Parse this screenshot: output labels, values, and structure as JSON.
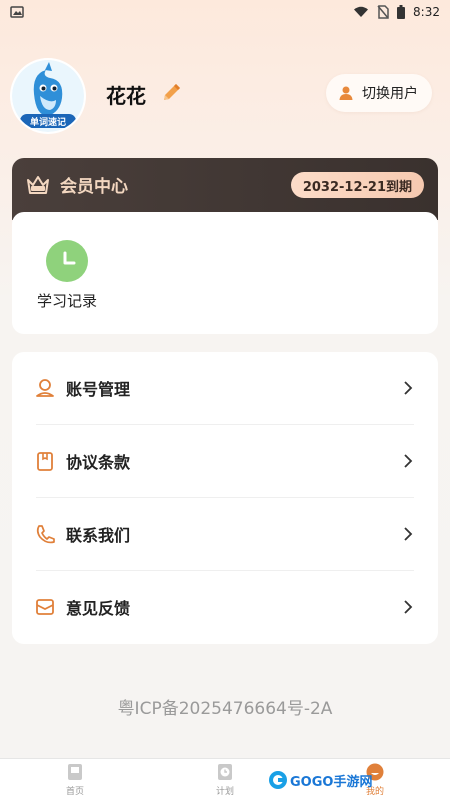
{
  "status_bar": {
    "time": "8:32"
  },
  "profile": {
    "username": "花花",
    "switch_user_label": "切换用户",
    "avatar_text": "单词速记"
  },
  "vip": {
    "title": "会员中心",
    "expiry": "2032-12-21到期"
  },
  "study": {
    "label": "学习记录"
  },
  "menu": [
    {
      "label": "账号管理",
      "icon": "user-circle-icon"
    },
    {
      "label": "协议条款",
      "icon": "document-icon"
    },
    {
      "label": "联系我们",
      "icon": "phone-icon"
    },
    {
      "label": "意见反馈",
      "icon": "mail-icon"
    }
  ],
  "icp": "粤ICP备2025476664号-2A",
  "nav": [
    {
      "label": "首页"
    },
    {
      "label": "计划"
    },
    {
      "label": "我的"
    }
  ],
  "watermark": "GOGO手游网",
  "colors": {
    "accent": "#e0803a",
    "vip_bg": "#3d3431",
    "green": "#8fd27c"
  }
}
